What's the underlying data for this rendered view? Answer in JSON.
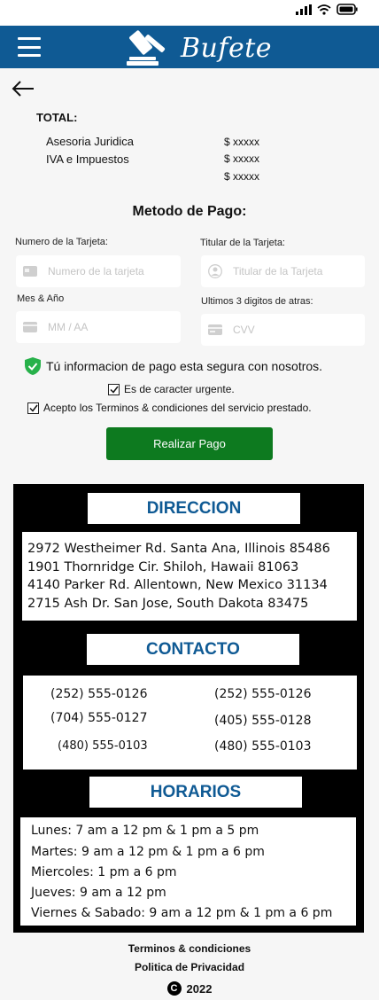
{
  "app": {
    "brand_name": "Bufete"
  },
  "summary": {
    "total_label": "TOTAL:",
    "items": [
      {
        "label": "Asesoria Juridica",
        "value": "$ xxxxx"
      },
      {
        "label": "IVA e Impuestos",
        "value": "$ xxxxx"
      },
      {
        "label": "",
        "value": "$ xxxxx"
      }
    ]
  },
  "payment": {
    "title": "Metodo de Pago:",
    "card_number_label": "Numero de la Tarjeta:",
    "card_number_placeholder": "Numero de la tarjeta",
    "card_holder_label": "Titular de la Tarjeta:",
    "card_holder_placeholder": "Titular de la Tarjeta",
    "expiry_label": "Mes & Año",
    "expiry_placeholder": "MM / AA",
    "cvv_label": "Ultimos 3 digitos de atras:",
    "cvv_placeholder": "CVV",
    "secure_message": "Tú informacion de pago esta segura con nosotros.",
    "urgent_label": "Es de caracter urgente.",
    "terms_label": "Acepto los Terminos & condiciones del servicio prestado.",
    "pay_button": "Realizar Pago"
  },
  "direccion": {
    "title": "DIRECCION",
    "lines": [
      "2972 Westheimer Rd. Santa Ana, Illinois 85486",
      "1901 Thornridge Cir. Shiloh, Hawaii 81063",
      "4140 Parker Rd. Allentown, New Mexico 31134",
      "2715 Ash Dr. San Jose, South Dakota 83475"
    ]
  },
  "contacto": {
    "title": "CONTACTO",
    "phones": [
      "(252) 555-0126",
      "(252) 555-0126",
      "(704) 555-0127",
      "(405) 555-0128",
      "(480) 555-0103",
      "(480) 555-0103"
    ]
  },
  "horarios": {
    "title": "HORARIOS",
    "lines": [
      "Lunes: 7 am a 12 pm & 1 pm a 5 pm",
      "Martes: 9 am a 12 pm & 1 pm a 6 pm",
      "Miercoles: 1 pm a 6 pm",
      "Jueves: 9 am a 12 pm",
      "Viernes & Sabado: 9 am a 12 pm & 1 pm a 6 pm"
    ]
  },
  "footer": {
    "terms": "Terminos & condiciones",
    "privacy": "Politica de Privacidad",
    "copyright_symbol": "C",
    "year": "2022"
  },
  "colors": {
    "primary": "#0f5a94",
    "pay_button": "#0d7a1f",
    "shield": "#27b14a"
  },
  "icons": [
    "signal-icon",
    "wifi-icon",
    "battery-icon",
    "menu-icon",
    "gavel-icon",
    "back-arrow-icon",
    "card-icon",
    "user-icon",
    "calendar-card-icon",
    "cvv-card-icon",
    "shield-check-icon",
    "checkbox-checked-icon",
    "copyright-icon"
  ]
}
